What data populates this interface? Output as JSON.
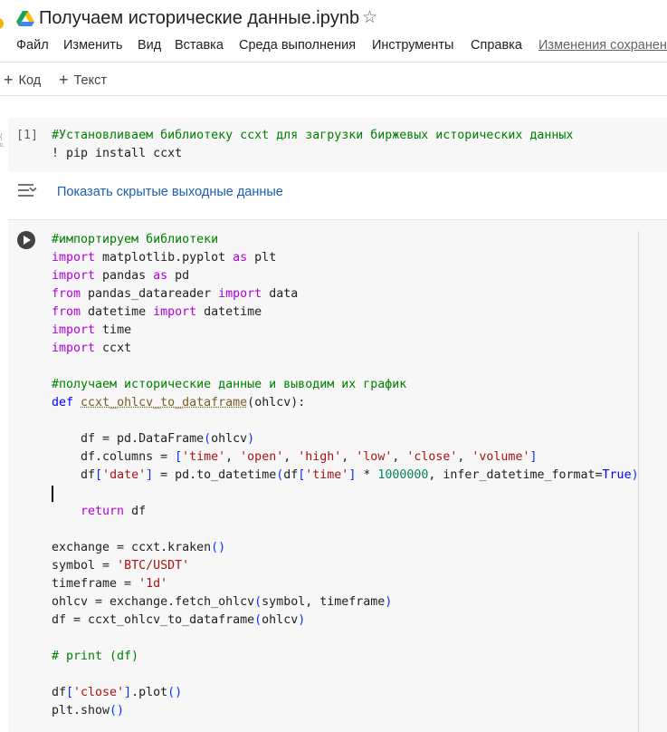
{
  "document": {
    "title": "Получаем исторические данные.ipynb"
  },
  "menu": {
    "items": [
      "Файл",
      "Изменить",
      "Вид",
      "Вставка",
      "Среда выполнения",
      "Инструменты",
      "Справка"
    ],
    "status": "Изменения сохранены"
  },
  "toolbar": {
    "add_code": "Код",
    "add_text": "Текст",
    "plus_glyph": "+"
  },
  "cell1": {
    "exec_count": "[1]",
    "comment": "#Установливаем библиотеку ccxt для загрузки биржевых исторических данных",
    "line2": "! pip install ccxt"
  },
  "output": {
    "link_label": "Показать скрытые выходные данные"
  },
  "cell2": {
    "c_import": "#импортируем библиотеки",
    "kw_import": "import",
    "kw_from": "from",
    "kw_as": "as",
    "kw_def": "def",
    "kw_return": "return",
    "t_matplotlib": " matplotlib.pyplot ",
    "t_plt": " plt",
    "t_pandas": " pandas ",
    "t_pd": " pd",
    "t_pdr": " pandas_datareader ",
    "t_data": " data",
    "t_datetime_mod": " datetime ",
    "t_datetime": " datetime",
    "t_time": " time",
    "t_ccxt": " ccxt",
    "c_get": "#получаем исторические данные и выводим их график",
    "fn_name": "ccxt_ohlcv_to_dataframe",
    "fn_params": "ohlcv):",
    "l_df1": "    df = pd.DataFrame",
    "l_df1_arg": "ohlcv",
    "l_cols": "    df.columns = ",
    "s_time": "'time'",
    "s_open": "'open'",
    "s_high": "'high'",
    "s_low": "'low'",
    "s_close": "'close'",
    "s_volume": "'volume'",
    "s_date": "'date'",
    "l_date1": "    df",
    "l_date2": " = pd.to_datetime",
    "l_date3": "df",
    "l_date4": " * ",
    "n_million": "1000000",
    "l_date5": ", infer_datetime_format=",
    "kw_true": "True",
    "t_df": " df",
    "l_exchange": "exchange = ccxt.kraken",
    "l_symbol": "symbol = ",
    "s_symbol": "'BTC/USDT'",
    "l_timeframe": "timeframe = ",
    "s_timeframe": "'1d'",
    "l_ohlcv": "ohlcv = exchange.fetch_ohlcv",
    "l_ohlcv_args": "symbol, timeframe",
    "l_df2": "df = ccxt_ohlcv_to_dataframe",
    "l_df2_arg": "ohlcv",
    "c_print": "# print (df)",
    "l_plot1": "df",
    "l_plot2": ".plot",
    "l_show": "plt.show"
  }
}
